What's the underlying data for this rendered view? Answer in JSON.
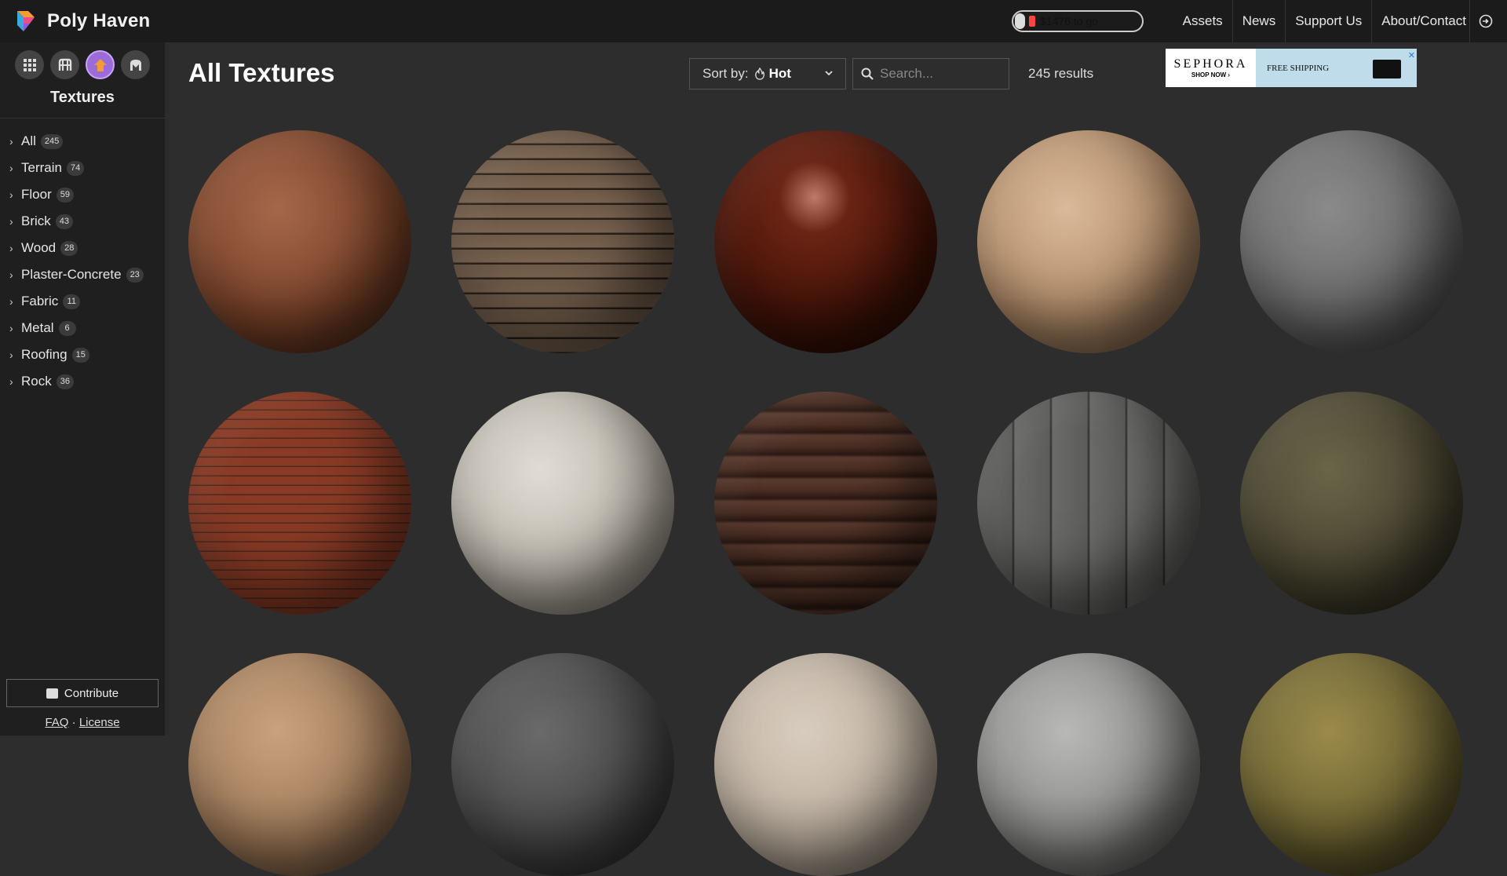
{
  "header": {
    "brand": "Poly Haven",
    "progress_text": "$1476 to go",
    "progress_fraction": 0.08,
    "nav": [
      "Assets",
      "News",
      "Support Us",
      "About/Contact"
    ]
  },
  "sidebar": {
    "type_icons": [
      "all-assets-icon",
      "hdri-icon",
      "textures-icon",
      "models-icon"
    ],
    "section_title": "Textures",
    "categories": [
      {
        "label": "All",
        "count": "245"
      },
      {
        "label": "Terrain",
        "count": "74"
      },
      {
        "label": "Floor",
        "count": "59"
      },
      {
        "label": "Brick",
        "count": "43"
      },
      {
        "label": "Wood",
        "count": "28"
      },
      {
        "label": "Plaster-Concrete",
        "count": "23"
      },
      {
        "label": "Fabric",
        "count": "11"
      },
      {
        "label": "Metal",
        "count": "6"
      },
      {
        "label": "Roofing",
        "count": "15"
      },
      {
        "label": "Rock",
        "count": "36"
      }
    ],
    "contribute": "Contribute",
    "faq": "FAQ",
    "separator": "·",
    "license": "License"
  },
  "main": {
    "title": "All Textures",
    "sort_label": "Sort by:",
    "sort_value": "Hot",
    "search_placeholder": "Search...",
    "results": "245 results"
  },
  "ad": {
    "brand": "SEPHORA",
    "cta": "SHOP NOW ›",
    "offer": "FREE SHIPPING"
  },
  "colors": {
    "accent": "#9a6bd9",
    "topbar": "#1b1b1b",
    "sidebar": "#1f1f1f",
    "background": "#2d2d2d"
  }
}
